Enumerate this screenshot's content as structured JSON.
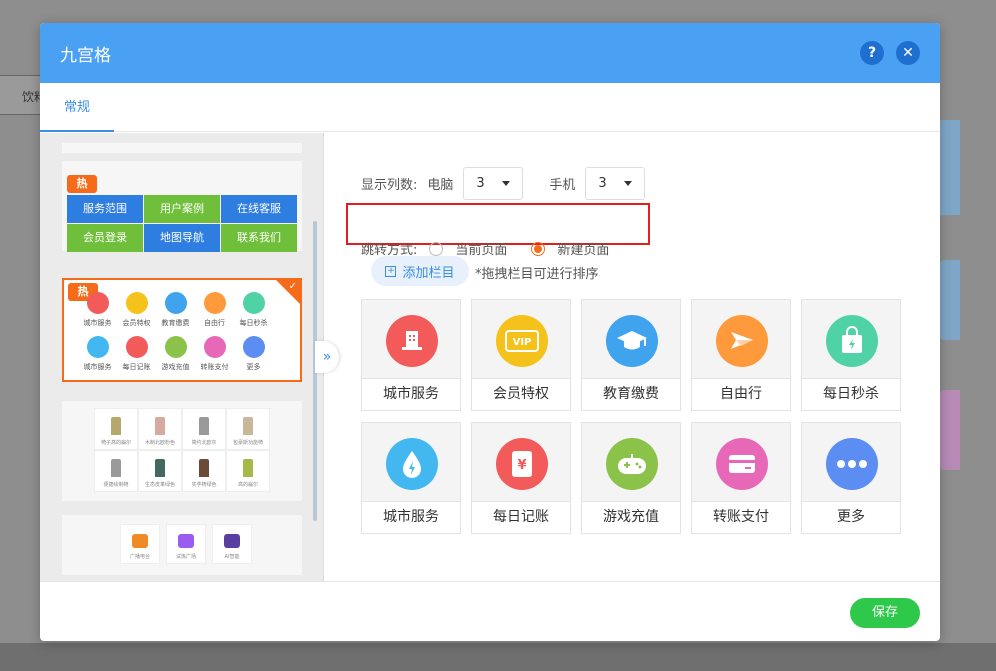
{
  "background": {
    "tab_label": "饮料"
  },
  "dialog": {
    "title": "九宫格",
    "help_label": "?",
    "close_label": "✕",
    "tab": "常规",
    "save_label": "保存"
  },
  "preview": {
    "hot_badge": "热",
    "collapse_label": "»",
    "template1_cells": [
      {
        "label": "服务范围",
        "color": "#2e7de1"
      },
      {
        "label": "用户案例",
        "color": "#6fbf3a"
      },
      {
        "label": "在线客服",
        "color": "#2e7de1"
      },
      {
        "label": "会员登录",
        "color": "#6fbf3a"
      },
      {
        "label": "地图导航",
        "color": "#2e7de1"
      },
      {
        "label": "联系我们",
        "color": "#6fbf3a"
      }
    ],
    "template2_items": [
      {
        "label": "城市服务",
        "color": "#f35b5b"
      },
      {
        "label": "会员特权",
        "color": "#f5c21b"
      },
      {
        "label": "教育缴费",
        "color": "#3fa3ee"
      },
      {
        "label": "自由行",
        "color": "#ff9a3c"
      },
      {
        "label": "每日秒杀",
        "color": "#4fd3a6"
      },
      {
        "label": "城市服务",
        "color": "#43b8f0"
      },
      {
        "label": "每日记账",
        "color": "#f35b5b"
      },
      {
        "label": "游戏充值",
        "color": "#8bc34a"
      },
      {
        "label": "转账支付",
        "color": "#e868b8"
      },
      {
        "label": "更多",
        "color": "#5b8df2"
      }
    ],
    "template3_items": [
      "椅子高的扁尔",
      "木制北欧粉色",
      "简约北欧灰",
      "包豪斯功能椅",
      "便捷绘制椅",
      "生态皮革绿色",
      "实芋椅绿色",
      "高的扁尔"
    ],
    "template4_items": [
      "广播电台",
      "试炼广场",
      "AI智能"
    ]
  },
  "settings": {
    "columns_label": "显示列数:",
    "pc_label": "电脑",
    "pc_value": "3",
    "mobile_label": "手机",
    "mobile_value": "3",
    "jump_label": "跳转方式:",
    "option_current": "当前页面",
    "option_new": "新建页面",
    "selected_option": "new",
    "add_button": "添加栏目",
    "hint": "*拖拽栏目可进行排序"
  },
  "items": [
    {
      "label": "城市服务",
      "icon": "building-icon",
      "color": "#f35b5b"
    },
    {
      "label": "会员特权",
      "icon": "vip-icon",
      "color": "#f5c21b"
    },
    {
      "label": "教育缴费",
      "icon": "graduation-cap-icon",
      "color": "#3fa3ee"
    },
    {
      "label": "自由行",
      "icon": "paper-plane-icon",
      "color": "#ff9a3c"
    },
    {
      "label": "每日秒杀",
      "icon": "shopping-bag-icon",
      "color": "#4fd3a6"
    },
    {
      "label": "城市服务",
      "icon": "water-drop-icon",
      "color": "#43b8f0"
    },
    {
      "label": "每日记账",
      "icon": "yen-ticket-icon",
      "color": "#f35b5b"
    },
    {
      "label": "游戏充值",
      "icon": "gamepad-icon",
      "color": "#8bc34a"
    },
    {
      "label": "转账支付",
      "icon": "card-icon",
      "color": "#e868b8"
    },
    {
      "label": "更多",
      "icon": "more-dots-icon",
      "color": "#5b8df2"
    }
  ]
}
